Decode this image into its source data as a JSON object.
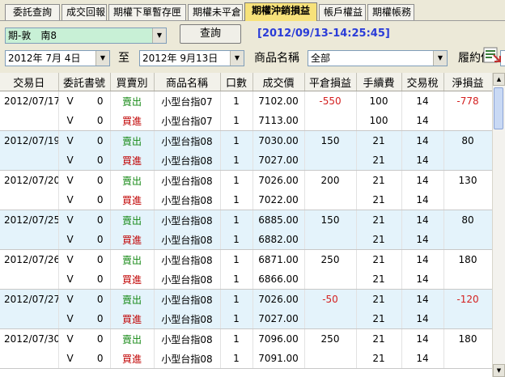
{
  "tabs": [
    {
      "label": "委託查詢",
      "active": false
    },
    {
      "label": "成交回報",
      "active": false
    },
    {
      "label": "期權下單暫存匣",
      "active": false
    },
    {
      "label": "期權未平倉",
      "active": false
    },
    {
      "label": "期權沖銷損益",
      "active": true
    },
    {
      "label": "帳戶權益",
      "active": false
    },
    {
      "label": "期權帳務",
      "active": false
    }
  ],
  "filters": {
    "account_value": "期-敦　南8",
    "query_label": "查詢",
    "timestamp": "[2012/09/13-14:25:45]",
    "date_from": "2012年  7月  4日",
    "to_label": "至",
    "date_to": "2012年  9月13日",
    "product_label": "商品名稱",
    "product_value": "全部",
    "strike_label": "履約價"
  },
  "table": {
    "columns": [
      "交易日",
      "委託書號",
      "買賣別",
      "商品名稱",
      "口數",
      "成交價",
      "平倉損益",
      "手續費",
      "交易稅",
      "淨損益"
    ],
    "rows": [
      {
        "date": "2012/07/17",
        "order_v": "V",
        "order_n": "0",
        "side": "賣出",
        "side_type": "sell",
        "product": "小型台指07",
        "qty": "1",
        "price": "7102.00",
        "pnl": "-550",
        "pnl_neg": true,
        "fee": "100",
        "tax": "14",
        "net": "-778",
        "net_neg": true,
        "shade": false
      },
      {
        "date": "",
        "order_v": "V",
        "order_n": "0",
        "side": "買進",
        "side_type": "buy",
        "product": "小型台指07",
        "qty": "1",
        "price": "7113.00",
        "pnl": "",
        "pnl_neg": false,
        "fee": "100",
        "tax": "14",
        "net": "",
        "net_neg": false,
        "shade": false
      },
      {
        "date": "2012/07/19",
        "order_v": "V",
        "order_n": "0",
        "side": "賣出",
        "side_type": "sell",
        "product": "小型台指08",
        "qty": "1",
        "price": "7030.00",
        "pnl": "150",
        "pnl_neg": false,
        "fee": "21",
        "tax": "14",
        "net": "80",
        "net_neg": false,
        "shade": true
      },
      {
        "date": "",
        "order_v": "V",
        "order_n": "0",
        "side": "買進",
        "side_type": "buy",
        "product": "小型台指08",
        "qty": "1",
        "price": "7027.00",
        "pnl": "",
        "pnl_neg": false,
        "fee": "21",
        "tax": "14",
        "net": "",
        "net_neg": false,
        "shade": true
      },
      {
        "date": "2012/07/20",
        "order_v": "V",
        "order_n": "0",
        "side": "賣出",
        "side_type": "sell",
        "product": "小型台指08",
        "qty": "1",
        "price": "7026.00",
        "pnl": "200",
        "pnl_neg": false,
        "fee": "21",
        "tax": "14",
        "net": "130",
        "net_neg": false,
        "shade": false
      },
      {
        "date": "",
        "order_v": "V",
        "order_n": "0",
        "side": "買進",
        "side_type": "buy",
        "product": "小型台指08",
        "qty": "1",
        "price": "7022.00",
        "pnl": "",
        "pnl_neg": false,
        "fee": "21",
        "tax": "14",
        "net": "",
        "net_neg": false,
        "shade": false
      },
      {
        "date": "2012/07/25",
        "order_v": "V",
        "order_n": "0",
        "side": "賣出",
        "side_type": "sell",
        "product": "小型台指08",
        "qty": "1",
        "price": "6885.00",
        "pnl": "150",
        "pnl_neg": false,
        "fee": "21",
        "tax": "14",
        "net": "80",
        "net_neg": false,
        "shade": true
      },
      {
        "date": "",
        "order_v": "V",
        "order_n": "0",
        "side": "買進",
        "side_type": "buy",
        "product": "小型台指08",
        "qty": "1",
        "price": "6882.00",
        "pnl": "",
        "pnl_neg": false,
        "fee": "21",
        "tax": "14",
        "net": "",
        "net_neg": false,
        "shade": true
      },
      {
        "date": "2012/07/26",
        "order_v": "V",
        "order_n": "0",
        "side": "賣出",
        "side_type": "sell",
        "product": "小型台指08",
        "qty": "1",
        "price": "6871.00",
        "pnl": "250",
        "pnl_neg": false,
        "fee": "21",
        "tax": "14",
        "net": "180",
        "net_neg": false,
        "shade": false
      },
      {
        "date": "",
        "order_v": "V",
        "order_n": "0",
        "side": "買進",
        "side_type": "buy",
        "product": "小型台指08",
        "qty": "1",
        "price": "6866.00",
        "pnl": "",
        "pnl_neg": false,
        "fee": "21",
        "tax": "14",
        "net": "",
        "net_neg": false,
        "shade": false
      },
      {
        "date": "2012/07/27",
        "order_v": "V",
        "order_n": "0",
        "side": "賣出",
        "side_type": "sell",
        "product": "小型台指08",
        "qty": "1",
        "price": "7026.00",
        "pnl": "-50",
        "pnl_neg": true,
        "fee": "21",
        "tax": "14",
        "net": "-120",
        "net_neg": true,
        "shade": true
      },
      {
        "date": "",
        "order_v": "V",
        "order_n": "0",
        "side": "買進",
        "side_type": "buy",
        "product": "小型台指08",
        "qty": "1",
        "price": "7027.00",
        "pnl": "",
        "pnl_neg": false,
        "fee": "21",
        "tax": "14",
        "net": "",
        "net_neg": false,
        "shade": true
      },
      {
        "date": "2012/07/30",
        "order_v": "V",
        "order_n": "0",
        "side": "賣出",
        "side_type": "sell",
        "product": "小型台指08",
        "qty": "1",
        "price": "7096.00",
        "pnl": "250",
        "pnl_neg": false,
        "fee": "21",
        "tax": "14",
        "net": "180",
        "net_neg": false,
        "shade": false
      },
      {
        "date": "",
        "order_v": "V",
        "order_n": "0",
        "side": "買進",
        "side_type": "buy",
        "product": "小型台指08",
        "qty": "1",
        "price": "7091.00",
        "pnl": "",
        "pnl_neg": false,
        "fee": "21",
        "tax": "14",
        "net": "",
        "net_neg": false,
        "shade": false
      }
    ]
  },
  "colors": {
    "sell": "#178a17",
    "buy": "#c00000",
    "negative": "#d42020",
    "active_tab": "#f7e27a",
    "timestamp": "#2a3cd8",
    "row_shade": "#e4f3fb"
  },
  "icons": {
    "toolbar_right": "export-icon",
    "dropdown": "chevron-down-icon"
  }
}
